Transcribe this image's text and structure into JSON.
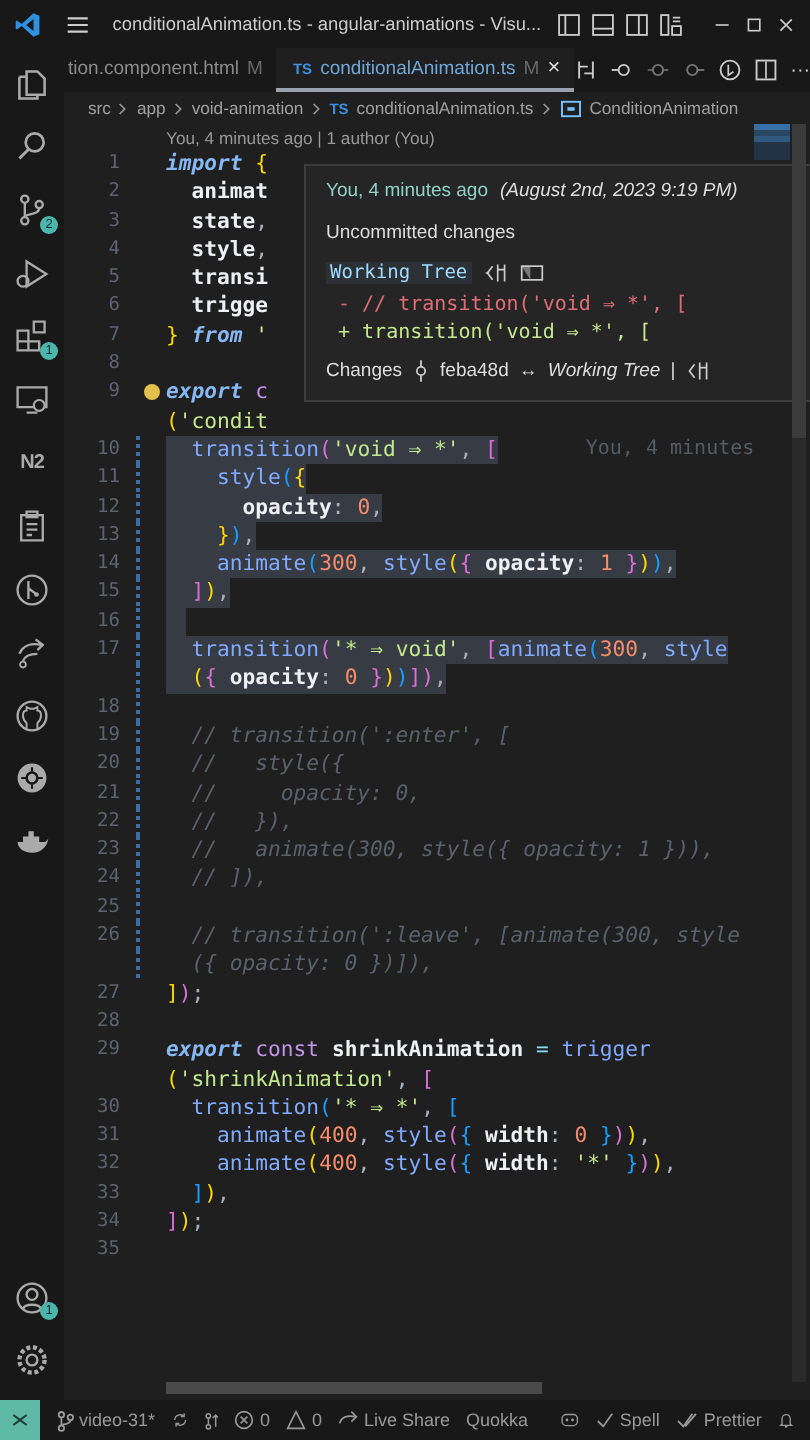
{
  "title_bar": {
    "title": "conditionalAnimation.ts - angular-animations - Visu..."
  },
  "activity_bar": {
    "top": [
      {
        "kind": "files"
      },
      {
        "kind": "search"
      },
      {
        "kind": "source-control",
        "badge": "2"
      },
      {
        "kind": "run"
      },
      {
        "kind": "extensions",
        "badge": "1"
      },
      {
        "kind": "remote"
      },
      {
        "kind": "text",
        "label": "N2"
      },
      {
        "kind": "clipboard"
      },
      {
        "kind": "git-graph"
      },
      {
        "kind": "live-share"
      },
      {
        "kind": "github"
      },
      {
        "kind": "kubernetes"
      },
      {
        "kind": "docker"
      }
    ],
    "bottom": [
      {
        "kind": "account",
        "badge": "1"
      },
      {
        "kind": "settings"
      }
    ]
  },
  "tabs": [
    {
      "label": "tion.component.html",
      "badge": "M",
      "selected": false
    },
    {
      "label": "conditionalAnimation.ts",
      "file_icon": "TS",
      "badge": "M",
      "close": "×",
      "selected": true
    }
  ],
  "editor_actions": [
    {
      "kind": "diff"
    },
    {
      "kind": "previous"
    },
    {
      "kind": "circle"
    },
    {
      "kind": "next"
    },
    {
      "kind": "timeline"
    },
    {
      "kind": "split"
    },
    {
      "kind": "text",
      "label": "···"
    }
  ],
  "breadcrumbs": [
    {
      "label": "src"
    },
    {
      "label": "app"
    },
    {
      "label": "void-animation"
    },
    {
      "label": "conditionalAnimation.ts",
      "file_icon": "TS"
    },
    {
      "label": "ConditionAnimation",
      "symbol": true
    }
  ],
  "codelens": "You, 4 minutes ago | 1 author (You)",
  "lines": [
    {
      "number": "1",
      "modified": false,
      "selected": false,
      "tokens": [
        {
          "kind": "kw",
          "text": "import"
        },
        {
          "kind": "b1",
          "text": " {"
        }
      ]
    },
    {
      "number": "2",
      "modified": false,
      "selected": false,
      "tokens": [
        {
          "kind": "id",
          "text": "  animat"
        }
      ]
    },
    {
      "number": "3",
      "modified": false,
      "selected": false,
      "tokens": [
        {
          "kind": "id",
          "text": "  state"
        },
        {
          "kind": "pun",
          "text": ","
        }
      ]
    },
    {
      "number": "4",
      "modified": false,
      "selected": false,
      "tokens": [
        {
          "kind": "id",
          "text": "  style"
        },
        {
          "kind": "pun",
          "text": ","
        }
      ]
    },
    {
      "number": "5",
      "modified": false,
      "selected": false,
      "tokens": [
        {
          "kind": "id",
          "text": "  transi"
        }
      ]
    },
    {
      "number": "6",
      "modified": false,
      "selected": false,
      "tokens": [
        {
          "kind": "id",
          "text": "  trigge"
        }
      ]
    },
    {
      "number": "7",
      "modified": false,
      "selected": false,
      "tokens": [
        {
          "kind": "b1",
          "text": "}"
        },
        {
          "kind": "kw",
          "text": " from"
        },
        {
          "kind": "str",
          "text": " '"
        }
      ]
    },
    {
      "number": "8",
      "modified": false,
      "selected": false
    },
    {
      "number": "9",
      "modified": false,
      "selected": false,
      "lightbulb": true,
      "tokens": [
        {
          "kind": "kw",
          "text": "export"
        },
        {
          "kind": "decl",
          "text": " c"
        }
      ],
      "wrap": [
        {
          "kind": "b1",
          "text": "("
        },
        {
          "kind": "str",
          "text": "'condit"
        }
      ]
    },
    {
      "number": "10",
      "modified": true,
      "selected": true,
      "blame": "You, 4 minutes",
      "tokens": [
        {
          "kind": "fn",
          "text": "  transition"
        },
        {
          "kind": "b2",
          "text": "("
        },
        {
          "kind": "str",
          "text": "'void ⇒ *'"
        },
        {
          "kind": "pun",
          "text": ", "
        },
        {
          "kind": "b2",
          "text": "["
        }
      ]
    },
    {
      "number": "11",
      "modified": true,
      "selected": true,
      "tokens": [
        {
          "kind": "fn",
          "text": "    style"
        },
        {
          "kind": "b3",
          "text": "("
        },
        {
          "kind": "b1",
          "text": "{"
        }
      ]
    },
    {
      "number": "12",
      "modified": true,
      "selected": true,
      "tokens": [
        {
          "kind": "id",
          "text": "      opacity"
        },
        {
          "kind": "pun",
          "text": ": "
        },
        {
          "kind": "num",
          "text": "0"
        },
        {
          "kind": "pun",
          "text": ","
        }
      ]
    },
    {
      "number": "13",
      "modified": true,
      "selected": true,
      "tokens": [
        {
          "kind": "b1",
          "text": "    }"
        },
        {
          "kind": "b3",
          "text": ")"
        },
        {
          "kind": "pun",
          "text": ","
        }
      ]
    },
    {
      "number": "14",
      "modified": true,
      "selected": true,
      "tokens": [
        {
          "kind": "fn",
          "text": "    animate"
        },
        {
          "kind": "b3",
          "text": "("
        },
        {
          "kind": "num",
          "text": "300"
        },
        {
          "kind": "pun",
          "text": ", "
        },
        {
          "kind": "fn",
          "text": "style"
        },
        {
          "kind": "b1",
          "text": "("
        },
        {
          "kind": "b2",
          "text": "{"
        },
        {
          "kind": "id",
          "text": " opacity"
        },
        {
          "kind": "pun",
          "text": ": "
        },
        {
          "kind": "num",
          "text": "1"
        },
        {
          "kind": "b2",
          "text": " }"
        },
        {
          "kind": "b1",
          "text": ")"
        },
        {
          "kind": "b3",
          "text": ")"
        },
        {
          "kind": "pun",
          "text": ","
        }
      ]
    },
    {
      "number": "15",
      "modified": true,
      "selected": true,
      "tokens": [
        {
          "kind": "b2",
          "text": "  ]"
        },
        {
          "kind": "b1",
          "text": ")"
        },
        {
          "kind": "pun",
          "text": ","
        }
      ]
    },
    {
      "number": "16",
      "modified": true,
      "selected": true
    },
    {
      "number": "17",
      "modified": true,
      "selected": true,
      "tokens": [
        {
          "kind": "fn",
          "text": "  transition"
        },
        {
          "kind": "b2",
          "text": "("
        },
        {
          "kind": "str",
          "text": "'* ⇒ void'"
        },
        {
          "kind": "pun",
          "text": ", "
        },
        {
          "kind": "b2",
          "text": "["
        },
        {
          "kind": "fn",
          "text": "animate"
        },
        {
          "kind": "b3",
          "text": "("
        },
        {
          "kind": "num",
          "text": "300"
        },
        {
          "kind": "pun",
          "text": ", "
        },
        {
          "kind": "fn",
          "text": "style"
        }
      ],
      "wrap": [
        {
          "kind": "b1",
          "text": "  ("
        },
        {
          "kind": "b2",
          "text": "{"
        },
        {
          "kind": "id",
          "text": " opacity"
        },
        {
          "kind": "pun",
          "text": ": "
        },
        {
          "kind": "num",
          "text": "0"
        },
        {
          "kind": "b2",
          "text": " }"
        },
        {
          "kind": "b1",
          "text": ")"
        },
        {
          "kind": "b3",
          "text": ")"
        },
        {
          "kind": "b2",
          "text": "])"
        },
        {
          "kind": "pun",
          "text": ","
        }
      ]
    },
    {
      "number": "18",
      "modified": true,
      "selected": false
    },
    {
      "number": "19",
      "modified": true,
      "selected": false,
      "tokens": [
        {
          "kind": "cmt",
          "text": "  // transition(':enter', ["
        }
      ]
    },
    {
      "number": "20",
      "modified": true,
      "selected": false,
      "tokens": [
        {
          "kind": "cmt",
          "text": "  //   style({"
        }
      ]
    },
    {
      "number": "21",
      "modified": true,
      "selected": false,
      "tokens": [
        {
          "kind": "cmt",
          "text": "  //     opacity: 0,"
        }
      ]
    },
    {
      "number": "22",
      "modified": true,
      "selected": false,
      "tokens": [
        {
          "kind": "cmt",
          "text": "  //   }),"
        }
      ]
    },
    {
      "number": "23",
      "modified": true,
      "selected": false,
      "tokens": [
        {
          "kind": "cmt",
          "text": "  //   animate(300, style({ opacity: 1 })),"
        }
      ]
    },
    {
      "number": "24",
      "modified": true,
      "selected": false,
      "tokens": [
        {
          "kind": "cmt",
          "text": "  // ]),"
        }
      ]
    },
    {
      "number": "25",
      "modified": true,
      "selected": false
    },
    {
      "number": "26",
      "modified": true,
      "selected": false,
      "tokens": [
        {
          "kind": "cmt",
          "text": "  // transition(':leave', [animate(300, style"
        }
      ],
      "wrap": [
        {
          "kind": "cmt",
          "text": "  ({ opacity: 0 })]),"
        }
      ]
    },
    {
      "number": "27",
      "modified": false,
      "selected": false,
      "tokens": [
        {
          "kind": "b1",
          "text": "]"
        },
        {
          "kind": "b2",
          "text": ")"
        },
        {
          "kind": "pun",
          "text": ";"
        }
      ]
    },
    {
      "number": "28",
      "modified": false,
      "selected": false
    },
    {
      "number": "29",
      "modified": false,
      "selected": false,
      "tokens": [
        {
          "kind": "kw",
          "text": "export"
        },
        {
          "kind": "decl",
          "text": " const"
        },
        {
          "kind": "id",
          "text": " shrinkAnimation"
        },
        {
          "kind": "op",
          "text": " ="
        },
        {
          "kind": "fn",
          "text": " trigger"
        }
      ],
      "wrap": [
        {
          "kind": "b1",
          "text": "("
        },
        {
          "kind": "str",
          "text": "'shrinkAnimation'"
        },
        {
          "kind": "pun",
          "text": ", "
        },
        {
          "kind": "b2",
          "text": "["
        }
      ]
    },
    {
      "number": "30",
      "modified": false,
      "selected": false,
      "tokens": [
        {
          "kind": "fn",
          "text": "  transition"
        },
        {
          "kind": "b3",
          "text": "("
        },
        {
          "kind": "str",
          "text": "'* ⇒ *'"
        },
        {
          "kind": "pun",
          "text": ", "
        },
        {
          "kind": "b3",
          "text": "["
        }
      ]
    },
    {
      "number": "31",
      "modified": false,
      "selected": false,
      "tokens": [
        {
          "kind": "fn",
          "text": "    animate"
        },
        {
          "kind": "b1",
          "text": "("
        },
        {
          "kind": "num",
          "text": "400"
        },
        {
          "kind": "pun",
          "text": ", "
        },
        {
          "kind": "fn",
          "text": "style"
        },
        {
          "kind": "b2",
          "text": "("
        },
        {
          "kind": "b3",
          "text": "{"
        },
        {
          "kind": "id",
          "text": " width"
        },
        {
          "kind": "pun",
          "text": ": "
        },
        {
          "kind": "num",
          "text": "0"
        },
        {
          "kind": "b3",
          "text": " }"
        },
        {
          "kind": "b2",
          "text": ")"
        },
        {
          "kind": "b1",
          "text": ")"
        },
        {
          "kind": "pun",
          "text": ","
        }
      ]
    },
    {
      "number": "32",
      "modified": false,
      "selected": false,
      "tokens": [
        {
          "kind": "fn",
          "text": "    animate"
        },
        {
          "kind": "b1",
          "text": "("
        },
        {
          "kind": "num",
          "text": "400"
        },
        {
          "kind": "pun",
          "text": ", "
        },
        {
          "kind": "fn",
          "text": "style"
        },
        {
          "kind": "b2",
          "text": "("
        },
        {
          "kind": "b3",
          "text": "{"
        },
        {
          "kind": "id",
          "text": " width"
        },
        {
          "kind": "pun",
          "text": ": "
        },
        {
          "kind": "str",
          "text": "'*'"
        },
        {
          "kind": "b3",
          "text": " }"
        },
        {
          "kind": "b2",
          "text": ")"
        },
        {
          "kind": "b1",
          "text": ")"
        },
        {
          "kind": "pun",
          "text": ","
        }
      ]
    },
    {
      "number": "33",
      "modified": false,
      "selected": false,
      "tokens": [
        {
          "kind": "b3",
          "text": "  ]"
        },
        {
          "kind": "b1",
          "text": ")"
        },
        {
          "kind": "pun",
          "text": ","
        }
      ]
    },
    {
      "number": "34",
      "modified": false,
      "selected": false,
      "tokens": [
        {
          "kind": "b2",
          "text": "]"
        },
        {
          "kind": "b1",
          "text": ")"
        },
        {
          "kind": "pun",
          "text": ";"
        }
      ]
    },
    {
      "number": "35",
      "modified": false,
      "selected": false
    }
  ],
  "hover": {
    "author": "You, 4 minutes ago",
    "date": "(August 2nd, 2023 9:19 PM)",
    "message": "Uncommitted changes",
    "tree_label": "Working Tree",
    "diff": [
      {
        "kind": "removed",
        "text": "- // transition('void ⇒ *', ["
      },
      {
        "kind": "added",
        "text": "+ transition('void ⇒ *', ["
      }
    ],
    "changes_label": "Changes",
    "commit": "feba48d",
    "arrow": "↔",
    "compare_label": "Working Tree",
    "separator": "|"
  },
  "status_bar": {
    "items": [
      {
        "kind": "branch",
        "label": "video-31*"
      },
      {
        "kind": "sync"
      },
      {
        "kind": "publish"
      },
      {
        "kind": "errors",
        "label": "0"
      },
      {
        "kind": "warnings",
        "label": "0"
      },
      {
        "kind": "live-share",
        "label": "Live Share"
      },
      {
        "kind": "plain",
        "label": "Quokka"
      }
    ],
    "right": [
      {
        "kind": "copilot"
      },
      {
        "kind": "check",
        "label": "Spell"
      },
      {
        "kind": "double-check",
        "label": "Prettier"
      },
      {
        "kind": "bell"
      }
    ]
  }
}
